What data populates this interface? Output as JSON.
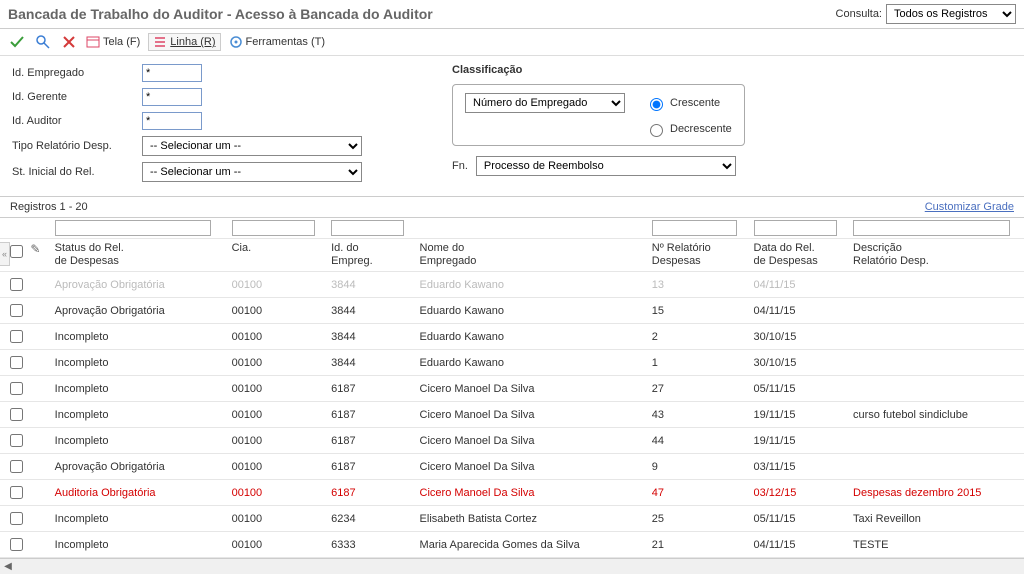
{
  "header": {
    "title": "Bancada de Trabalho do Auditor - Acesso à Bancada do Auditor",
    "consulta_label": "Consulta:",
    "consulta_value": "Todos os Registros"
  },
  "toolbar": {
    "tela": "Tela (F)",
    "linha": "Linha (R)",
    "ferramentas": "Ferramentas (T)"
  },
  "form": {
    "id_empregado_label": "Id. Empregado",
    "id_empregado_value": "*",
    "id_gerente_label": "Id. Gerente",
    "id_gerente_value": "*",
    "id_auditor_label": "Id. Auditor",
    "id_auditor_value": "*",
    "tipo_rel_label": "Tipo Relatório Desp.",
    "tipo_rel_value": "-- Selecionar um --",
    "st_inicial_label": "St. Inicial do Rel.",
    "st_inicial_value": "-- Selecionar um --",
    "fn_label": "Fn.",
    "fn_value": "Processo de Reembolso"
  },
  "classificacao": {
    "title": "Classificação",
    "select_value": "Número do Empregado",
    "crescente": "Crescente",
    "decrescente": "Decrescente"
  },
  "records_label": "Registros 1 - 20",
  "customize_label": "Customizar Grade",
  "columns": {
    "status": "Status do Rel.\nde Despesas",
    "cia": "Cia.",
    "emp": "Id. do\nEmpreg.",
    "nome": "Nome do\nEmpregado",
    "rel": "Nº Relatório\nDespesas",
    "data": "Data do Rel.\nde Despesas",
    "desc": "Descrição\nRelatório Desp."
  },
  "rows": [
    {
      "faded": true,
      "status": "Aprovação Obrigatória",
      "cia": "00100",
      "emp": "3844",
      "nome": "Eduardo Kawano",
      "rel": "13",
      "data": "04/11/15",
      "desc": ""
    },
    {
      "faded": false,
      "status": "Aprovação Obrigatória",
      "cia": "00100",
      "emp": "3844",
      "nome": "Eduardo Kawano",
      "rel": "15",
      "data": "04/11/15",
      "desc": ""
    },
    {
      "faded": false,
      "status": "Incompleto",
      "cia": "00100",
      "emp": "3844",
      "nome": "Eduardo Kawano",
      "rel": "2",
      "data": "30/10/15",
      "desc": ""
    },
    {
      "faded": false,
      "status": "Incompleto",
      "cia": "00100",
      "emp": "3844",
      "nome": "Eduardo Kawano",
      "rel": "1",
      "data": "30/10/15",
      "desc": ""
    },
    {
      "faded": false,
      "status": "Incompleto",
      "cia": "00100",
      "emp": "6187",
      "nome": "Cicero Manoel Da Silva",
      "rel": "27",
      "data": "05/11/15",
      "desc": ""
    },
    {
      "faded": false,
      "status": "Incompleto",
      "cia": "00100",
      "emp": "6187",
      "nome": "Cicero Manoel Da Silva",
      "rel": "43",
      "data": "19/11/15",
      "desc": "curso futebol sindiclube"
    },
    {
      "faded": false,
      "status": "Incompleto",
      "cia": "00100",
      "emp": "6187",
      "nome": "Cicero Manoel Da Silva",
      "rel": "44",
      "data": "19/11/15",
      "desc": ""
    },
    {
      "faded": false,
      "status": "Aprovação Obrigatória",
      "cia": "00100",
      "emp": "6187",
      "nome": "Cicero Manoel Da Silva",
      "rel": "9",
      "data": "03/11/15",
      "desc": ""
    },
    {
      "faded": false,
      "red": true,
      "status": "Auditoria Obrigatória",
      "cia": "00100",
      "emp": "6187",
      "nome": "Cicero Manoel Da Silva",
      "rel": "47",
      "data": "03/12/15",
      "desc": "Despesas dezembro 2015"
    },
    {
      "faded": false,
      "status": "Incompleto",
      "cia": "00100",
      "emp": "6234",
      "nome": "Elisabeth Batista Cortez",
      "rel": "25",
      "data": "05/11/15",
      "desc": "Taxi Reveillon"
    },
    {
      "faded": false,
      "status": "Incompleto",
      "cia": "00100",
      "emp": "6333",
      "nome": "Maria Aparecida Gomes da Silva",
      "rel": "21",
      "data": "04/11/15",
      "desc": "TESTE"
    }
  ]
}
